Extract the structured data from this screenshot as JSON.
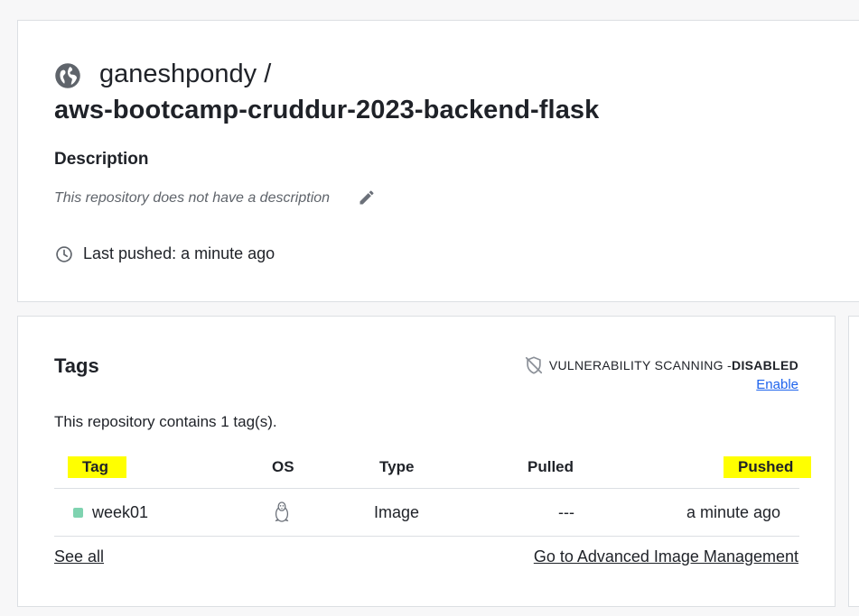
{
  "repo": {
    "owner": "ganeshpondy",
    "separator": "/",
    "name": "aws-bootcamp-cruddur-2023-backend-flask",
    "description_heading": "Description",
    "description_text": "This repository does not have a description",
    "last_pushed": "Last pushed: a minute ago"
  },
  "tags": {
    "title": "Tags",
    "vuln_label": "VULNERABILITY SCANNING - ",
    "vuln_status": "DISABLED",
    "enable_label": "Enable",
    "count_text": "This repository contains 1 tag(s).",
    "columns": {
      "tag": "Tag",
      "os": "OS",
      "type": "Type",
      "pulled": "Pulled",
      "pushed": "Pushed"
    },
    "rows": [
      {
        "tag": "week01",
        "os_icon": "linux-icon",
        "type": "Image",
        "pulled": "---",
        "pushed": "a minute ago"
      }
    ],
    "see_all": "See all",
    "advanced": "Go to Advanced Image Management"
  },
  "colors": {
    "highlight": "#ffff00",
    "link": "#1d63ed",
    "tag_status": "#7fd3b0"
  }
}
